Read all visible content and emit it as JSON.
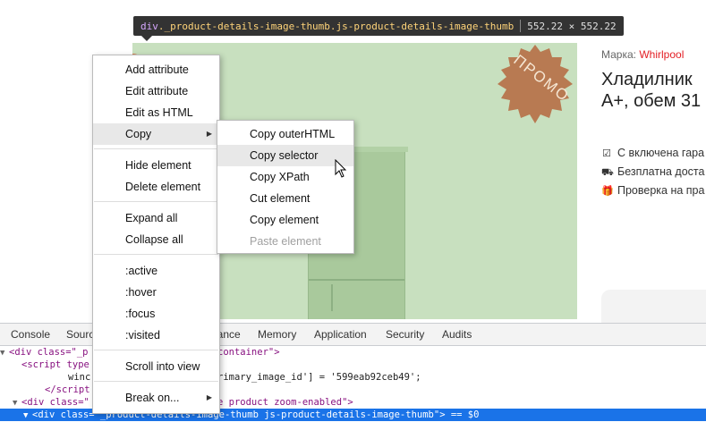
{
  "tooltip": {
    "tag": "div",
    "classes": "._product-details-image-thumb.js-product-details-image-thumb",
    "dimensions": "552.22 × 552.22"
  },
  "page": {
    "promo_text": "ПРОМО",
    "brand_label": "Марка:",
    "brand_name": "Whirlpool",
    "title_line1": "Хладилник",
    "title_line2": "А+, обем 31",
    "features": [
      {
        "icon": "checkbox-icon",
        "text": "С включена гара"
      },
      {
        "icon": "truck-icon",
        "text": "Безплатна доста"
      },
      {
        "icon": "gift-icon",
        "text": "Проверка на пра"
      }
    ]
  },
  "context_menu": {
    "items": [
      {
        "label": "Add attribute"
      },
      {
        "label": "Edit attribute"
      },
      {
        "label": "Edit as HTML"
      },
      {
        "label": "Copy",
        "submenu": true,
        "highlighted": true
      },
      {
        "label": "Hide element"
      },
      {
        "label": "Delete element"
      },
      {
        "label": "Expand all"
      },
      {
        "label": "Collapse all"
      },
      {
        "label": ":active"
      },
      {
        "label": ":hover"
      },
      {
        "label": ":focus"
      },
      {
        "label": ":visited"
      },
      {
        "label": "Scroll into view"
      },
      {
        "label": "Break on...",
        "submenu": true
      }
    ]
  },
  "copy_submenu": {
    "items": [
      {
        "label": "Copy outerHTML"
      },
      {
        "label": "Copy selector",
        "highlighted": true
      },
      {
        "label": "Copy XPath"
      },
      {
        "label": "Cut element"
      },
      {
        "label": "Copy element"
      },
      {
        "label": "Paste element",
        "disabled": true
      }
    ]
  },
  "devtools": {
    "tabs": [
      "Console",
      "Sourc",
      "nance",
      "Memory",
      "Application",
      "Security",
      "Audits"
    ],
    "lines": [
      {
        "p1": "<div class=\"_p",
        "p2": "container\">"
      },
      {
        "p1": "<script type",
        "p2": ""
      },
      {
        "p1": "winc",
        "p2": "rimary_image_id'] = '599eab92ceb49';"
      },
      {
        "p1": "</script",
        "p2": ""
      },
      {
        "p1": "<div class=\"",
        "p2": "e product zoom-enabled\">"
      },
      {
        "tag": "<div",
        "attr": " class=",
        "val": "\"_product-details-image-thumb js-product-details-image-thumb\"",
        "tail": "> == $0"
      }
    ]
  },
  "colors": {
    "image_bg": "#c8e0bf",
    "promo_badge": "#b87a52",
    "brand_accent": "#e31e24",
    "selection": "#1a73e8"
  }
}
